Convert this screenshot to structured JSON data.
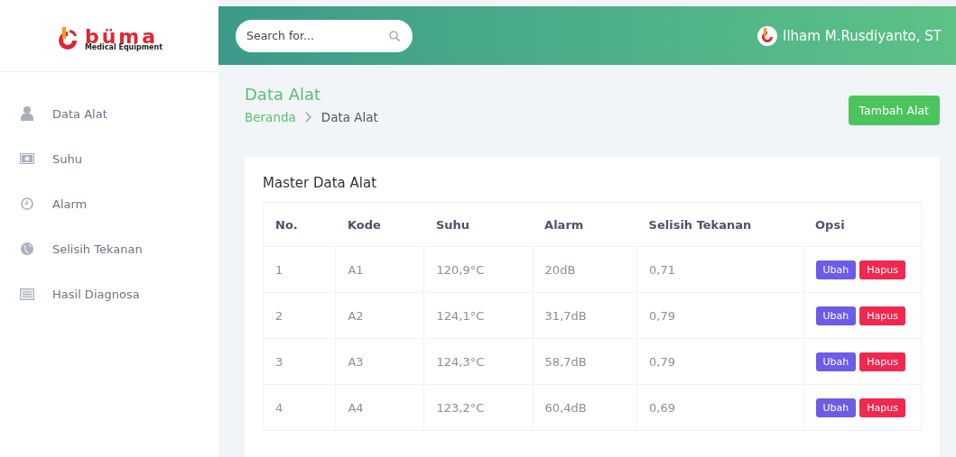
{
  "logo": {
    "name": "büma",
    "tagline": "Medical Equipment"
  },
  "search": {
    "placeholder": "Search for..."
  },
  "user": {
    "name": "Ilham M.Rusdiyanto, ST"
  },
  "sidebar": {
    "items": [
      {
        "label": "Data Alat",
        "kind": "user"
      },
      {
        "label": "Suhu",
        "kind": "money"
      },
      {
        "label": "Alarm",
        "kind": "clock"
      },
      {
        "label": "Selisih Tekanan",
        "kind": "globe"
      },
      {
        "label": "Hasil Diagnosa",
        "kind": "list"
      }
    ]
  },
  "page": {
    "title": "Data Alat",
    "breadcrumb": [
      "Beranda",
      "Data Alat"
    ],
    "add_button": "Tambah Alat"
  },
  "card": {
    "title": "Master Data Alat"
  },
  "table": {
    "columns": [
      "No.",
      "Kode",
      "Suhu",
      "Alarm",
      "Selisih Tekanan",
      "Opsi"
    ],
    "rows": [
      {
        "cells": [
          "1",
          "A1",
          "120,9°C",
          "20dB",
          "0,71"
        ],
        "actions": [
          "Ubah",
          "Hapus"
        ]
      },
      {
        "cells": [
          "2",
          "A2",
          "124,1°C",
          "31,7dB",
          "0,79"
        ],
        "actions": [
          "Ubah",
          "Hapus"
        ]
      },
      {
        "cells": [
          "3",
          "A3",
          "124,3°C",
          "58,7dB",
          "0,79"
        ],
        "actions": [
          "Ubah",
          "Hapus"
        ]
      },
      {
        "cells": [
          "4",
          "A4",
          "123,2°C",
          "60,4dB",
          "0,69"
        ],
        "actions": [
          "Ubah",
          "Hapus"
        ]
      }
    ]
  }
}
